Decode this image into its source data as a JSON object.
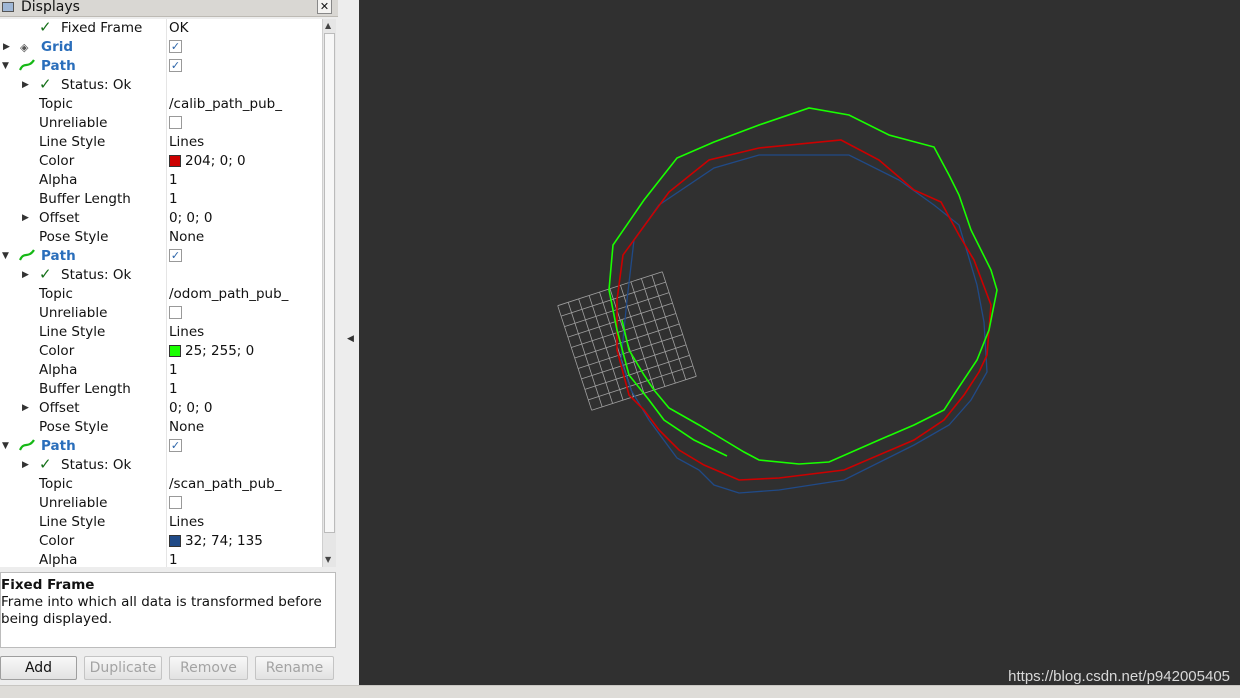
{
  "panel": {
    "title": "Displays",
    "close": "✕"
  },
  "rows": [
    {
      "label": "Fixed Frame",
      "value": "OK",
      "checked": true
    },
    {
      "label": "Grid",
      "checkbox": "✓"
    },
    {
      "label": "Path",
      "checkbox": "✓"
    },
    {
      "label": "Status: Ok"
    },
    {
      "label": "Topic",
      "value": "/calib_path_pub_"
    },
    {
      "label": "Unreliable",
      "checkbox": ""
    },
    {
      "label": "Line Style",
      "value": "Lines"
    },
    {
      "label": "Color",
      "value": "204; 0; 0",
      "swatch": "#cc0000"
    },
    {
      "label": "Alpha",
      "value": "1"
    },
    {
      "label": "Buffer Length",
      "value": "1"
    },
    {
      "label": "Offset",
      "value": "0; 0; 0"
    },
    {
      "label": "Pose Style",
      "value": "None"
    },
    {
      "label": "Path",
      "checkbox": "✓"
    },
    {
      "label": "Status: Ok"
    },
    {
      "label": "Topic",
      "value": "/odom_path_pub_"
    },
    {
      "label": "Unreliable",
      "checkbox": ""
    },
    {
      "label": "Line Style",
      "value": "Lines"
    },
    {
      "label": "Color",
      "value": "25; 255; 0",
      "swatch": "#19ff00"
    },
    {
      "label": "Alpha",
      "value": "1"
    },
    {
      "label": "Buffer Length",
      "value": "1"
    },
    {
      "label": "Offset",
      "value": "0; 0; 0"
    },
    {
      "label": "Pose Style",
      "value": "None"
    },
    {
      "label": "Path",
      "checkbox": "✓"
    },
    {
      "label": "Status: Ok"
    },
    {
      "label": "Topic",
      "value": "/scan_path_pub_"
    },
    {
      "label": "Unreliable",
      "checkbox": ""
    },
    {
      "label": "Line Style",
      "value": "Lines"
    },
    {
      "label": "Color",
      "value": "32; 74; 135",
      "swatch": "#204a87"
    },
    {
      "label": "Alpha",
      "value": "1"
    }
  ],
  "description": {
    "title": "Fixed Frame",
    "text": "Frame into which all data is transformed before being displayed."
  },
  "buttons": {
    "add": "Add",
    "duplicate": "Duplicate",
    "remove": "Remove",
    "rename": "Rename"
  },
  "viewport": {
    "background": "#303030",
    "grid_color": "#a0a0a0",
    "path_colors": {
      "calib": "#cc0000",
      "odom": "#19ff00",
      "scan": "#204a87"
    },
    "watermark": "https://blog.csdn.net/p942005405"
  }
}
